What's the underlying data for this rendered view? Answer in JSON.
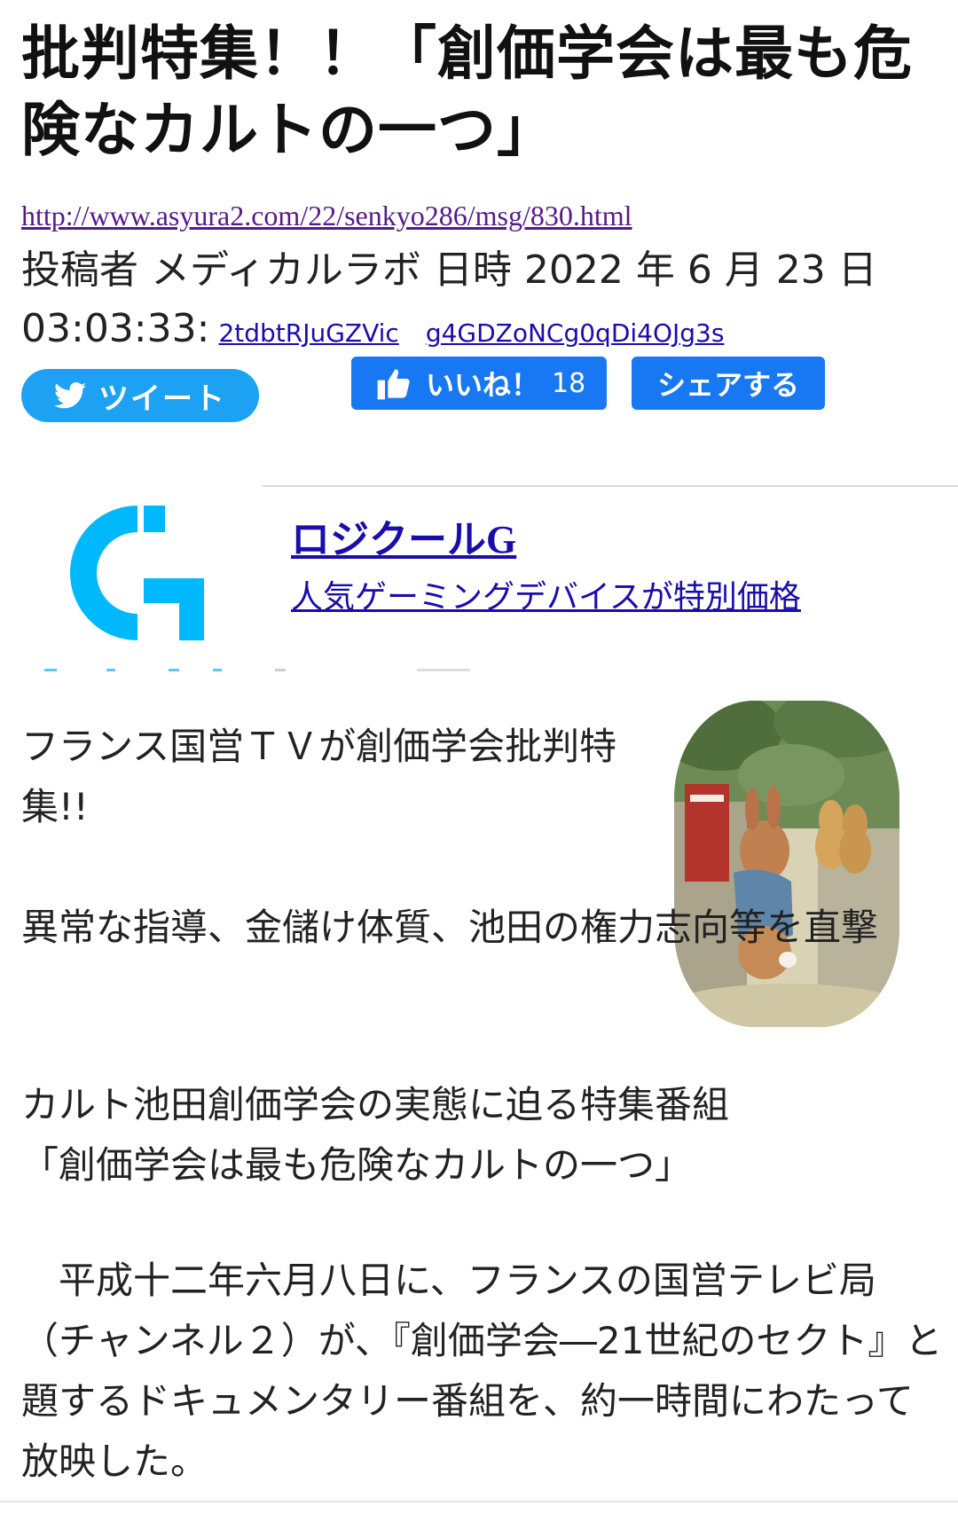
{
  "article": {
    "title": "批判特集！！「創価学会は最も危険なカルトの一つ」",
    "source_url": "http://www.asyura2.com/22/senkyo286/msg/830.html",
    "poster_line": "投稿者 メディカルラボ 日時 2022 年 6 月 23 日 03:03:33:",
    "poster_id_1": "2tdbtRJuGZVic",
    "poster_id_2": "g4GDZoNCg0qDi4OJg3s"
  },
  "social": {
    "tweet_label": "ツイート",
    "like_label": "いいね！",
    "like_count": "18",
    "share_label": "シェアする"
  },
  "ad": {
    "title": "ロジクールG",
    "description": "人気ゲーミングデバイスが特別価格",
    "logo_icon": "logitech-g-logo",
    "logo_color": "#00b8fc"
  },
  "body": {
    "para1": "フランス国営ＴＶが創価学会批判特集!!",
    "para2": "異常な指導、金儲け体質、池田の権力志向等を直撃",
    "para3_line1": "カルト池田創価学会の実態に迫る特集番組",
    "para3_line2": "「創価学会は最も危険なカルトの一つ」",
    "para4": "　平成十二年六月八日に、フランスの国営テレビ局（チャンネル２）が、『創価学会―21世紀のセクト』と題するドキュメンタリー番組を、約一時間にわたって放映した。"
  },
  "colors": {
    "tweet_blue": "#1da1f2",
    "facebook_blue": "#1877f2",
    "link_blue": "#1a0dab",
    "visited_purple": "#551a8b"
  }
}
